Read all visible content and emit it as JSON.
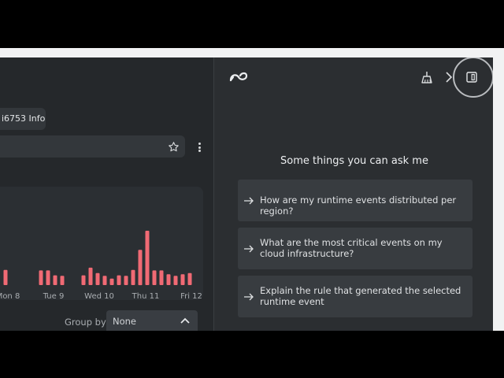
{
  "colors": {
    "bar": "#f06a74",
    "axis_text": "#a9adb1",
    "panel": "#2b2e31"
  },
  "left": {
    "filter_chip": "i6753 Info",
    "star_icon": "star-outline-icon",
    "more_icon": "kebab-vertical-icon",
    "group_by_label": "Group by",
    "group_by_value": "None"
  },
  "chart_data": {
    "type": "bar",
    "title": "",
    "xlabel": "",
    "ylabel": "",
    "ylim": [
      0,
      100
    ],
    "tick_labels": [
      "Mon 8",
      "Tue 9",
      "Wed 10",
      "Thu 11",
      "Fri 12"
    ],
    "values": [
      28,
      0,
      0,
      0,
      0,
      27,
      27,
      18,
      17,
      0,
      0,
      18,
      32,
      22,
      17,
      12,
      18,
      17,
      28,
      65,
      100,
      27,
      27,
      20,
      17,
      20,
      22
    ]
  },
  "assistant": {
    "heading": "Some things you can ask me",
    "suggestions": [
      "How are my runtime events distributed per region?",
      "What are the most critical events on my cloud infrastructure?",
      "Explain the rule that generated the selected runtime event"
    ],
    "icons": [
      "assistant-logo-icon",
      "broom-icon",
      "chevron-right-icon",
      "side-panel-icon"
    ]
  }
}
